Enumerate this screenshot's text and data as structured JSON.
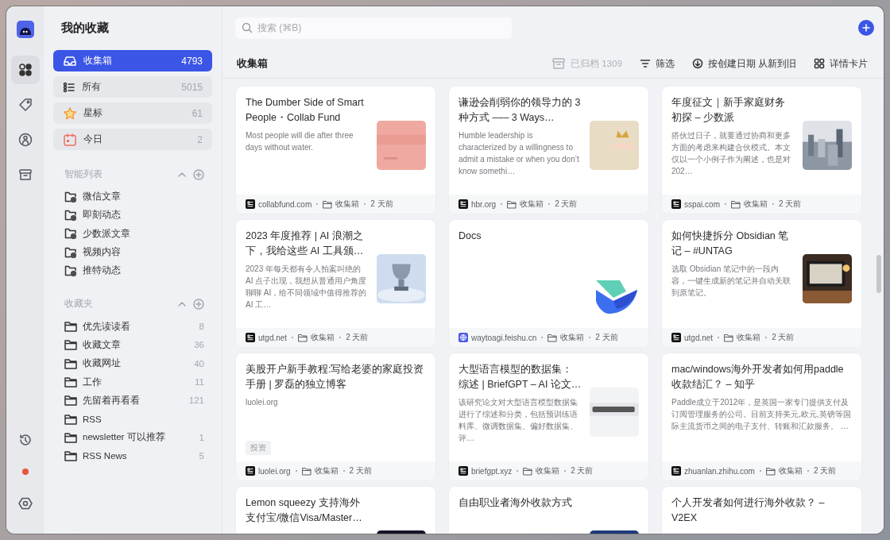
{
  "rail": {
    "top": [
      {
        "kind": "apps",
        "selected": true
      },
      {
        "kind": "tag",
        "selected": false
      },
      {
        "kind": "person",
        "selected": false
      },
      {
        "kind": "archive",
        "selected": false
      }
    ],
    "bottom": [
      {
        "kind": "history"
      },
      {
        "kind": "status"
      },
      {
        "kind": "settings"
      }
    ]
  },
  "sidebar": {
    "title": "我的收藏",
    "nav": [
      {
        "kind": "inbox",
        "label": "收集箱",
        "count": "4793",
        "selected": true
      },
      {
        "kind": "list",
        "label": "所有",
        "count": "5015",
        "selected": false
      },
      {
        "kind": "star",
        "label": "星标",
        "count": "61",
        "selected": false
      },
      {
        "kind": "calendar",
        "label": "今日",
        "count": "2",
        "selected": false
      }
    ],
    "sections": [
      {
        "kind": "smart",
        "title": "智能列表",
        "expanded": true,
        "items": [
          {
            "label": "微信文章"
          },
          {
            "label": "即刻动态"
          },
          {
            "label": "少数派文章"
          },
          {
            "label": "视频内容"
          },
          {
            "label": "推特动态"
          }
        ]
      },
      {
        "kind": "folder",
        "title": "收藏夹",
        "expanded": true,
        "items": [
          {
            "label": "优先读读看",
            "count": "8"
          },
          {
            "label": "收藏文章",
            "count": "36"
          },
          {
            "label": "收藏网址",
            "count": "40"
          },
          {
            "label": "工作",
            "count": "11"
          },
          {
            "label": "先留着再看看",
            "count": "121"
          },
          {
            "label": "RSS"
          },
          {
            "label": "newsletter 可以推荐",
            "count": "1"
          },
          {
            "label": "RSS News",
            "count": "5"
          }
        ]
      }
    ]
  },
  "search": {
    "placeholder": "搜索 (⌘B)"
  },
  "header": {
    "title": "收集箱",
    "toolbar": [
      {
        "kind": "archive",
        "label": "已归档 1309",
        "disabled": true
      },
      {
        "kind": "filter",
        "label": "筛选",
        "disabled": false
      },
      {
        "kind": "sort",
        "label": "按创建日期 从新到旧",
        "disabled": false
      },
      {
        "kind": "grid",
        "label": "详情卡片",
        "disabled": false
      }
    ]
  },
  "cards": [
    {
      "title": "The Dumber Side of Smart People・Collab Fund",
      "description": "Most people will die after three days without water.",
      "source": {
        "kind": "page",
        "label": "collabfund.com"
      },
      "folder": "收集箱",
      "time": "2 天前"
    },
    {
      "title": "谦逊会削弱你的领导力的 3 种方式 ––– 3 Ways…",
      "description": "Humble leadership is characterized by a willingness to admit a mistake or when you don’t know somethi…",
      "source": {
        "kind": "page",
        "label": "hbr.org"
      },
      "folder": "收集箱",
      "time": "2 天前"
    },
    {
      "title": "年度征文｜新手家庭财务初探 – 少数派",
      "description": "搭伙过日子，就要通过协商和更多方面的考虑来构建合伙模式。本文仅以一个小例子作为阐述，也是对 202…",
      "source": {
        "kind": "page",
        "label": "sspai.com"
      },
      "folder": "收集箱",
      "time": "2 天前"
    },
    {
      "title": "2023 年度推荐 | AI 浪潮之下，我给这些 AI 工具颁…",
      "description": "2023 年每天都有令人拍案叫绝的 AI 点子出现，我想从普通用户角度聊聊 AI，给不同领域中值得推荐的 AI 工…",
      "source": {
        "kind": "page",
        "label": "utgd.net"
      },
      "folder": "收集箱",
      "time": "2 天前"
    },
    {
      "title": "Docs",
      "thumbnail": {
        "kind": "logo"
      },
      "source": {
        "kind": "globe",
        "label": "waytoagi.feishu.cn"
      },
      "folder": "收集箱",
      "time": "2 天前"
    },
    {
      "title": "如何快捷拆分 Obsidian 笔记 – #UNTAG",
      "description": "选取 Obsidian 笔记中的一段内容，一键生成新的笔记并自动关联到原笔记。",
      "source": {
        "kind": "page",
        "label": "utgd.net"
      },
      "folder": "收集箱",
      "time": "2 天前"
    },
    {
      "title": "美股开户新手教程:写给老婆的家庭投资手册 | 罗磊的独立博客",
      "description": "luolei.org",
      "tag": "投资",
      "source": {
        "kind": "page",
        "label": "luolei.org"
      },
      "folder": "收集箱",
      "time": "2 天前"
    },
    {
      "title": "大型语言模型的数据集：综述 | BriefGPT – AI 论文…",
      "description": "该研究论文对大型语言模型数据集进行了综述和分类，包括预训练语料库、微调数据集、偏好数据集、评…",
      "source": {
        "kind": "page",
        "label": "briefgpt.xyz"
      },
      "folder": "收集箱",
      "time": "2 天前"
    },
    {
      "title": "mac/windows海外开发者如何用paddle收款结汇？ – 知乎",
      "description": "Paddle成立于2012年，是英国一家专门提供支付及订阅管理服务的公司。目前支持美元,欧元,英镑等国际主流货币之间的电子支付、转账和汇款服务。 …",
      "source": {
        "kind": "page",
        "label": "zhuanlan.zhihu.com"
      },
      "folder": "收集箱",
      "time": "2 天前"
    },
    {
      "title": "Lemon squeezy 支持海外支付宝/微信Visa/Master…"
    },
    {
      "title": "自由职业者海外收款方式"
    },
    {
      "title": "个人开发者如何进行海外收款？ – V2EX"
    }
  ]
}
